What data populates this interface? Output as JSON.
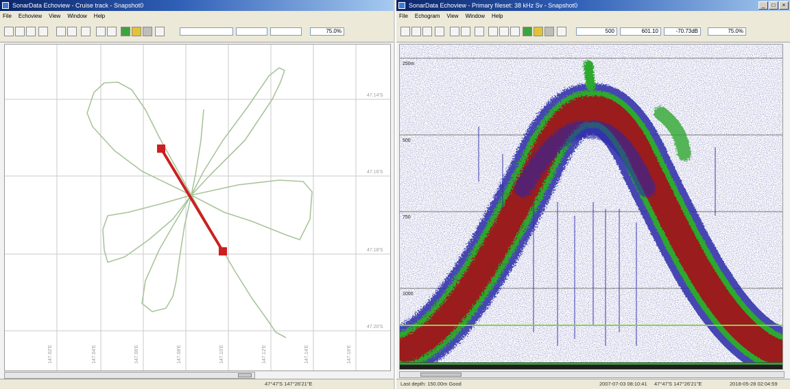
{
  "left_window": {
    "title": "SonarData Echoview - Cruise track - Snapshot0",
    "menu": [
      "File",
      "Echoview",
      "View",
      "Window",
      "Help"
    ],
    "window_buttons": [
      "_",
      "□",
      "×"
    ],
    "toolbar": {
      "zoom_field": "75.0%"
    },
    "track_view": {
      "latitude_labels": [
        "47.14'S",
        "47.16'S",
        "47.18'S",
        "47.20'S"
      ],
      "longitude_labels": [
        "147.02'E",
        "147.04'E",
        "147.06'E",
        "147.08'E",
        "147.10'E",
        "147.12'E",
        "147.14'E",
        "147.16'E"
      ],
      "colors": {
        "track": "#a8c49a",
        "segment": "#cc1f1f",
        "grid": "#c8c8c8"
      }
    },
    "status": {
      "position": "47°47'S 147°26'21\"E"
    }
  },
  "right_window": {
    "title": "SonarData Echoview - Primary fileset: 38 kHz Sv - Snapshot0",
    "menu": [
      "File",
      "Echogram",
      "View",
      "Window",
      "Help"
    ],
    "window_buttons": [
      "_",
      "□",
      "×"
    ],
    "toolbar": {
      "field_1": "500",
      "field_2": "601.10",
      "field_3": "-70.73dB",
      "zoom_field": "75.0%"
    },
    "echogram": {
      "depth_labels": [
        "250m",
        "500",
        "750",
        "1000"
      ],
      "colors": {
        "strong": "#9a1c1c",
        "medium": "#2ea82e",
        "weak": "#2a2aa8",
        "line": "#8cd04a"
      }
    },
    "status": {
      "left": "Last depth: 150.00m Good",
      "time": "2007-07-03 08:10:41",
      "position": "47°47'S 147°26'21\"E",
      "date": "2018-05-28 02:04:59"
    }
  }
}
